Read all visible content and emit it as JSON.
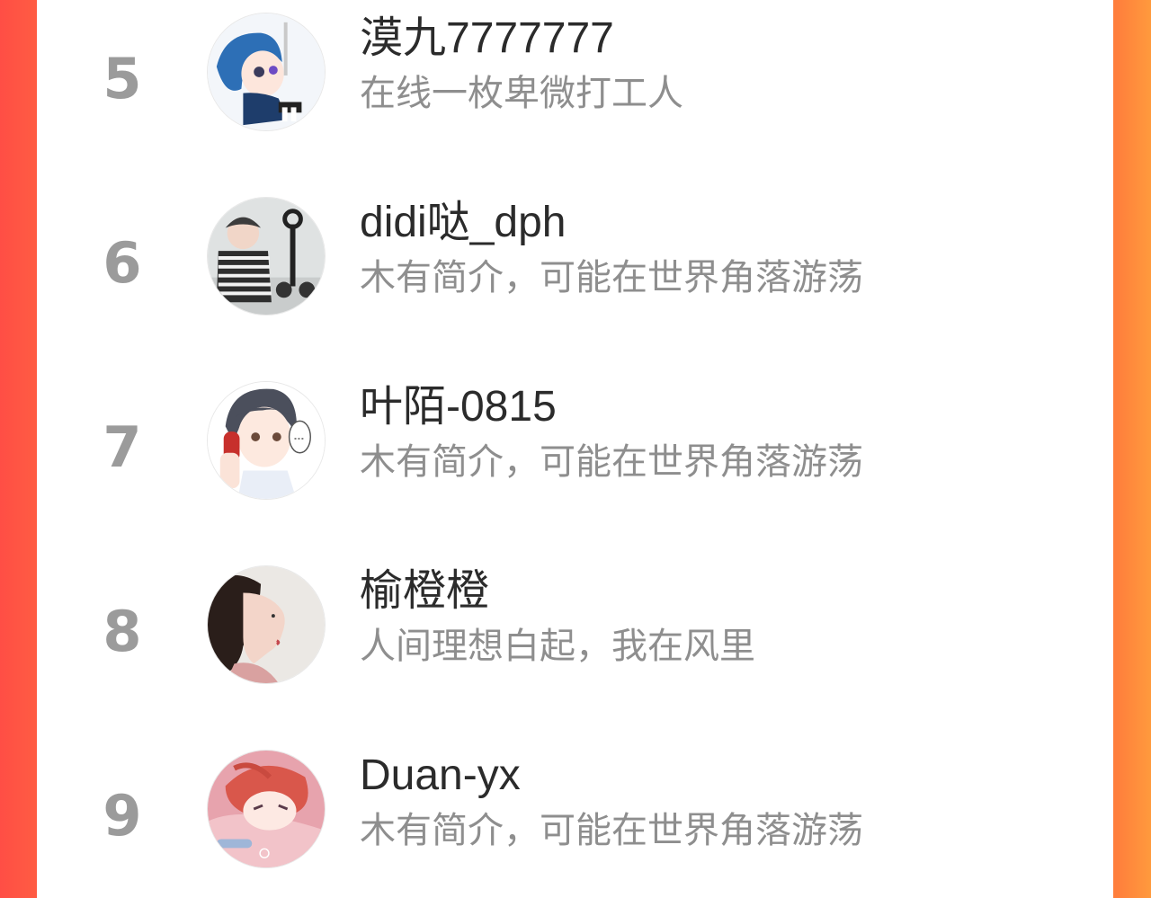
{
  "users": [
    {
      "rank": "5",
      "name": "漠九7777777",
      "bio": "在线一枚卑微打工人",
      "avatar": "anime-girl-blue-hair-avatar"
    },
    {
      "rank": "6",
      "name": "didi哒_dph",
      "bio": "木有简介，可能在世界角落游荡",
      "avatar": "child-striped-shirt-avatar"
    },
    {
      "rank": "7",
      "name": "叶陌-0815",
      "bio": "木有简介，可能在世界角落游荡",
      "avatar": "anime-boy-headphones-avatar"
    },
    {
      "rank": "8",
      "name": "榆橙橙",
      "bio": "人间理想白起，我在风里",
      "avatar": "woman-profile-avatar"
    },
    {
      "rank": "9",
      "name": "Duan-yx",
      "bio": "木有简介，可能在世界角落游荡",
      "avatar": "anime-pink-illustration-avatar"
    }
  ],
  "colors": {
    "background_left": "#ff4e45",
    "background_right": "#ff9a3d",
    "rank_gray": "#9b9b9b",
    "name_dark": "#2b2b2b",
    "bio_gray": "#8e8e8e"
  }
}
